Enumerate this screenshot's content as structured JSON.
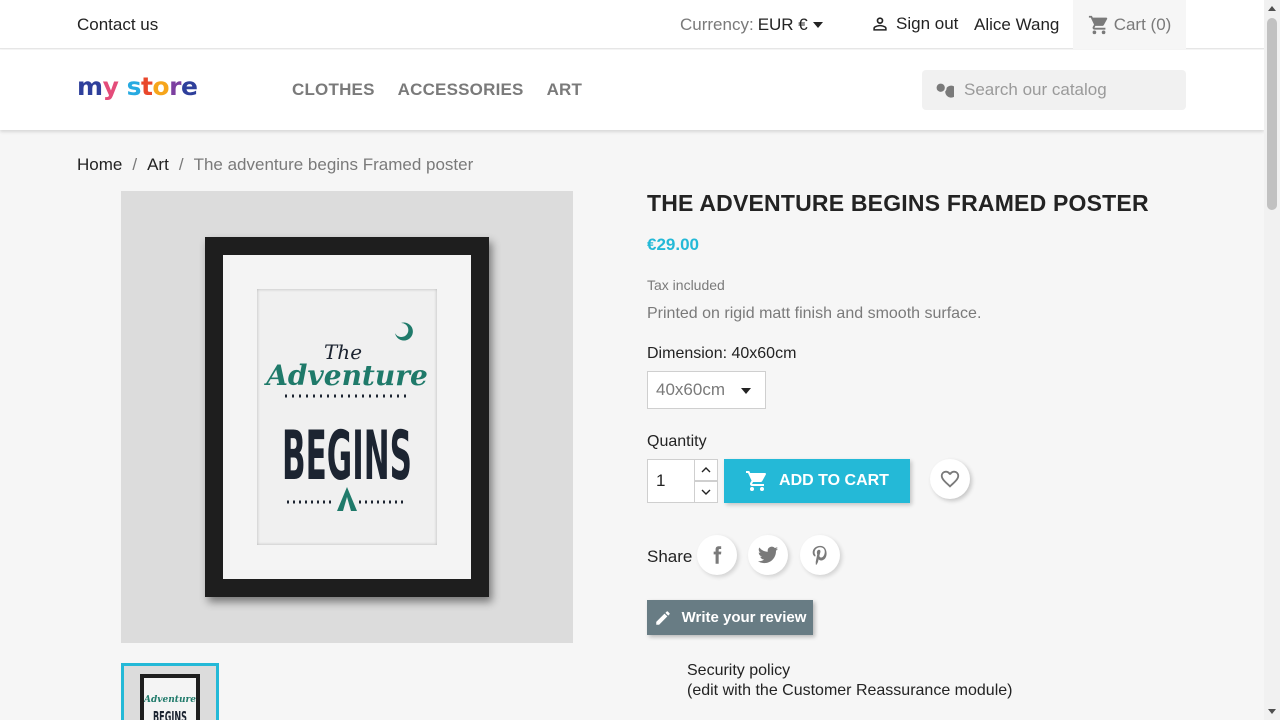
{
  "topbar": {
    "contact": "Contact us",
    "currency_label": "Currency:",
    "currency_value": "EUR €",
    "signout": "Sign out",
    "username": "Alice Wang",
    "cart": "Cart (0)"
  },
  "header": {
    "logo": "my store",
    "nav": [
      "CLOTHES",
      "ACCESSORIES",
      "ART"
    ],
    "search_placeholder": "Search our catalog"
  },
  "breadcrumb": {
    "home": "Home",
    "category": "Art",
    "current": "The adventure begins Framed poster",
    "separator": "/"
  },
  "product": {
    "title": "THE ADVENTURE BEGINS FRAMED POSTER",
    "price": "€29.00",
    "tax": "Tax included",
    "description": "Printed on rigid matt finish and smooth surface.",
    "dimension_label": "Dimension: 40x60cm",
    "dimension_value": "40x60cm",
    "quantity_label": "Quantity",
    "quantity_value": "1",
    "add_to_cart": "ADD TO CART",
    "share_label": "Share",
    "review_button": "Write your review",
    "security_line1": "Security policy",
    "security_line2": "(edit with the Customer Reassurance module)",
    "poster_text": {
      "the": "The",
      "adventure": "Adventure",
      "begins": "BEGINS"
    }
  },
  "colors": {
    "accent": "#24b9d7",
    "review_button": "#687c84",
    "poster_green": "#1f7a6a",
    "poster_navy": "#1c2431"
  },
  "icons": [
    "person-icon",
    "cart-icon",
    "search-icon",
    "caret-down-icon",
    "chevron-up-icon",
    "chevron-down-icon",
    "heart-icon",
    "facebook-icon",
    "twitter-icon",
    "pinterest-icon",
    "pencil-icon"
  ]
}
